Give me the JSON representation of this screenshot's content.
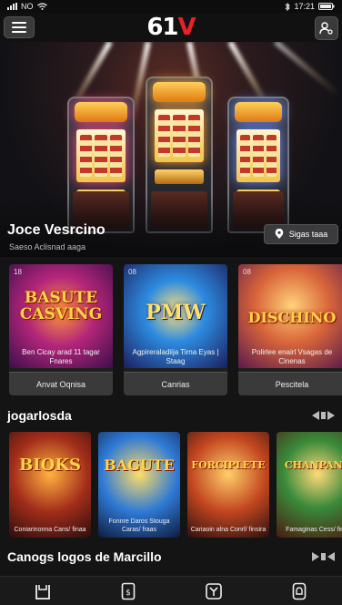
{
  "status_bar": {
    "carrier": "NO",
    "time": "17:21"
  },
  "header": {
    "logo_text": "61",
    "logo_accent": "V"
  },
  "hero": {
    "title": "Joce Vesrcino",
    "subtitle": "Saeso Aclisnad aaga",
    "button_label": "Sigas taaa"
  },
  "featured": [
    {
      "badge": "18",
      "art_title": "BASUTE CASVING",
      "description": "Ben Cicay arad 11 tagar Fnares",
      "cta": "Anvat Oqnisa"
    },
    {
      "badge": "08",
      "art_title": "PMW",
      "description": "Agpireraladiija Tirna Eyas | Staag",
      "cta": "Canrias"
    },
    {
      "badge": "08",
      "art_title": "DISCHINO",
      "description": "Polirlee enairl Vsagas de Cinenas",
      "cta": "Pescitela"
    }
  ],
  "section1": {
    "title": "jogarlosda"
  },
  "games": [
    {
      "title": "BIOKS",
      "description": "Coniarinonna Cans/ finaa"
    },
    {
      "title": "BAGUTE",
      "description": "Fonnre Daros Stouga Caras/ fraas"
    },
    {
      "title": "FORCIPLETE",
      "description": "Cariaoin alna Conrl/ finsira"
    },
    {
      "title": "CHANPANE",
      "description": "Famaginas Cess/ finta"
    }
  ],
  "section2": {
    "title": "Canogs logos de Marcillo"
  },
  "bottom_nav": [
    "home-icon",
    "promo-icon",
    "casino-icon",
    "account-icon"
  ],
  "colors": {
    "brand_red": "#e8202a",
    "background": "#141414",
    "button": "#3a3a3a"
  }
}
